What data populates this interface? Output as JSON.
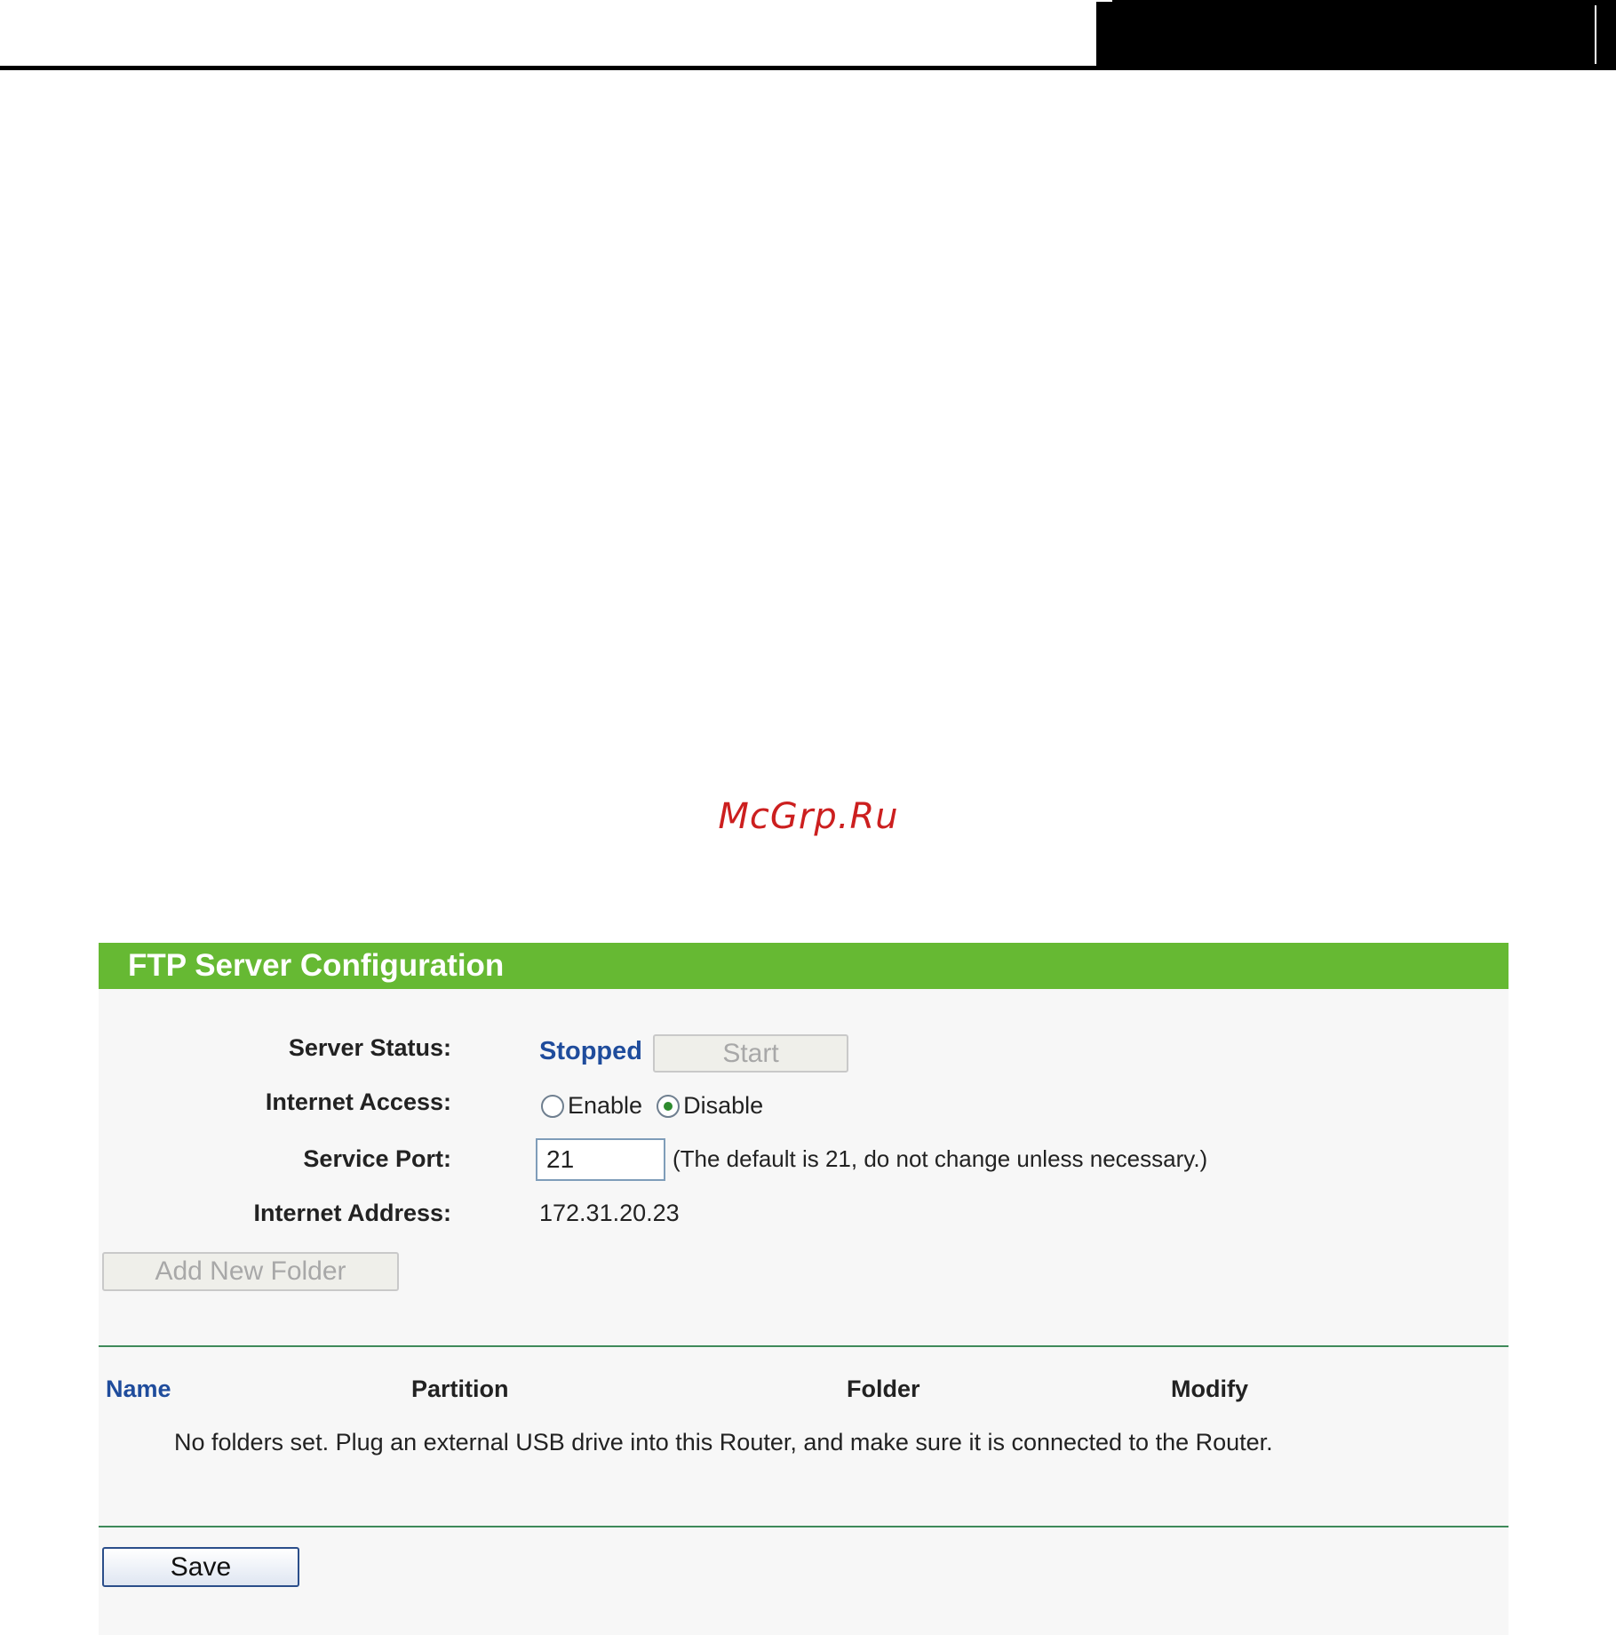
{
  "watermark": "McGrp.Ru",
  "panel": {
    "title": "FTP Server Configuration"
  },
  "server_status": {
    "label": "Server Status:",
    "value": "Stopped",
    "start_button": "Start"
  },
  "internet_access": {
    "label": "Internet Access:",
    "options": [
      {
        "label": "Enable",
        "selected": false
      },
      {
        "label": "Disable",
        "selected": true
      }
    ]
  },
  "service_port": {
    "label": "Service Port:",
    "value": "21",
    "hint": "(The default is 21, do not change unless necessary.)"
  },
  "internet_address": {
    "label": "Internet Address:",
    "value": "172.31.20.23"
  },
  "add_folder_button": "Add New Folder",
  "table": {
    "columns": [
      "Name",
      "Partition",
      "Folder",
      "Modify"
    ],
    "empty_message": "No folders set. Plug an external USB drive into this Router, and make sure it is connected to the Router."
  },
  "save_button": "Save",
  "colors": {
    "title_bar": "#66b933",
    "status_text": "#1f4c9c",
    "divider": "#3f8a5a",
    "panel_background": "#f7f7f7"
  }
}
